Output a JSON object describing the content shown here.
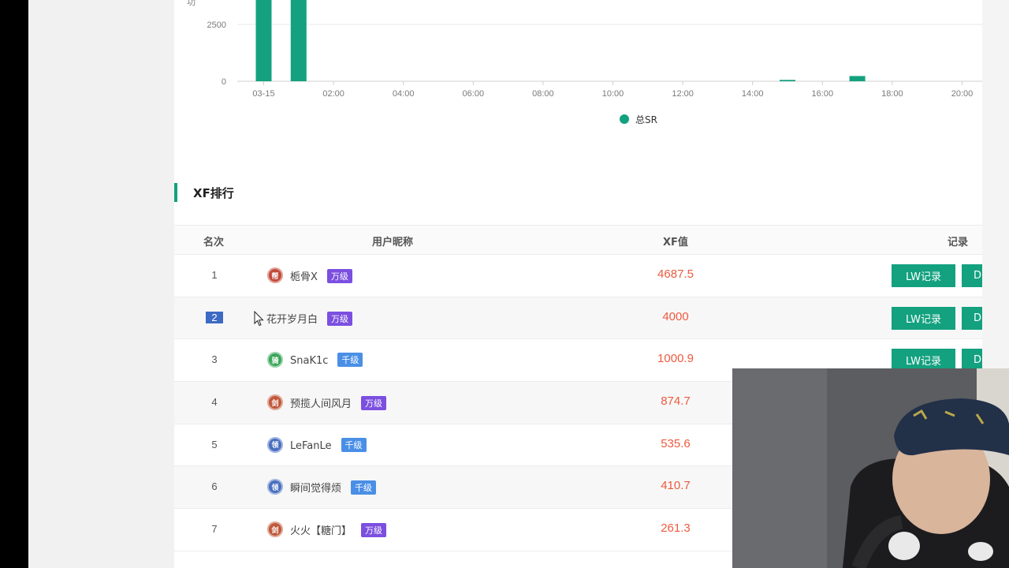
{
  "chart": {
    "series_name": "总SR",
    "colors": {
      "series": "#13a17f",
      "grid": "#e8e8e8",
      "axis_text": "#7a7a7a"
    },
    "y_ticks": [
      "2500",
      "0"
    ],
    "x_ticks": [
      "03-15",
      "02:00",
      "04:00",
      "06:00",
      "08:00",
      "10:00",
      "12:00",
      "14:00",
      "16:00",
      "18:00",
      "20:00"
    ],
    "y_axis_label_partial": "功"
  },
  "chart_data": {
    "type": "bar",
    "title": "",
    "x": [
      "03-15 00:00",
      "03-15 01:00",
      "03-15 15:00",
      "03-15 17:00"
    ],
    "series": [
      {
        "name": "总SR",
        "values": [
          4500,
          4500,
          60,
          230
        ]
      }
    ],
    "xlabel": "",
    "ylabel": "",
    "ylim_visible": [
      0,
      2500
    ],
    "legend": "bottom-center",
    "grid": true
  },
  "section": {
    "title": "XF排行"
  },
  "table": {
    "headers": {
      "rank": "名次",
      "nickname": "用户昵称",
      "xf": "XF值",
      "record": "记录"
    },
    "rows": [
      {
        "rank": "1",
        "badge": "帮",
        "badge_color": "#c24a3a",
        "nickname": "栀骨X",
        "level": "万级",
        "level_color": "#7b4fe0",
        "xf": "4687.5",
        "lw": "LW记录",
        "d": "D"
      },
      {
        "rank": "2",
        "badge": "",
        "badge_color": "",
        "nickname": "花开岁月白",
        "level": "万级",
        "level_color": "#7b4fe0",
        "xf": "4000",
        "lw": "LW记录",
        "d": "D",
        "selected": true
      },
      {
        "rank": "3",
        "badge": "骑",
        "badge_color": "#3aa65a",
        "nickname": "SnaK1c",
        "level": "千级",
        "level_color": "#4a8fe6",
        "xf": "1000.9",
        "lw": "LW记录",
        "d": "D"
      },
      {
        "rank": "4",
        "badge": "剑",
        "badge_color": "#c0583a",
        "nickname": "预揽人间风月",
        "level": "万级",
        "level_color": "#7b4fe0",
        "xf": "874.7"
      },
      {
        "rank": "5",
        "badge": "领",
        "badge_color": "#4a6fc0",
        "nickname": "LeFanLe",
        "level": "千级",
        "level_color": "#4a8fe6",
        "xf": "535.6"
      },
      {
        "rank": "6",
        "badge": "领",
        "badge_color": "#4a6fc0",
        "nickname": "瞬间觉得烦",
        "level": "千级",
        "level_color": "#4a8fe6",
        "xf": "410.7"
      },
      {
        "rank": "7",
        "badge": "剑",
        "badge_color": "#c0583a",
        "nickname": "火火【糖门】",
        "level": "万级",
        "level_color": "#7b4fe0",
        "xf": "261.3"
      }
    ]
  }
}
